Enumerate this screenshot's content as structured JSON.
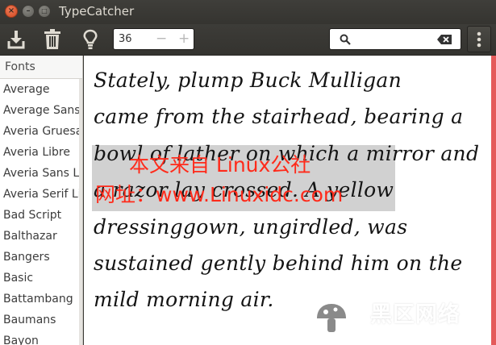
{
  "window": {
    "title": "TypeCatcher",
    "close_glyph": "×",
    "minimize_glyph": "–",
    "maximize_glyph": "□"
  },
  "toolbar": {
    "download_icon": "download-icon",
    "delete_icon": "trash-icon",
    "info_icon": "lightbulb-icon",
    "font_size": "36",
    "decrease_label": "−",
    "increase_label": "+",
    "search_value": "",
    "search_icon": "search-icon",
    "clear_icon": "backspace-clear-icon",
    "menu_icon": "vertical-ellipsis-icon"
  },
  "sidebar": {
    "header": "Fonts",
    "items": [
      {
        "label": "Average"
      },
      {
        "label": "Average Sans"
      },
      {
        "label": "Averia Gruesa"
      },
      {
        "label": "Averia Libre"
      },
      {
        "label": "Averia Sans Li"
      },
      {
        "label": "Averia Serif Li"
      },
      {
        "label": "Bad Script"
      },
      {
        "label": "Balthazar"
      },
      {
        "label": "Bangers"
      },
      {
        "label": "Basic"
      },
      {
        "label": "Battambang"
      },
      {
        "label": "Baumans"
      },
      {
        "label": "Bayon"
      }
    ]
  },
  "preview": {
    "lines": [
      "Stately, plump Buck Mulligan",
      "came from the stairhead, bearing a",
      "bowl of lather on which a mirror and",
      "a razor lay crossed. A yellow",
      "dressinggown, ungirdled, was",
      "sustained gently behind him on the",
      "mild morning air."
    ]
  },
  "watermark": {
    "line1": "本文来自 Linux公社",
    "line2": "网址：www.Linuxidc.com",
    "color": "#ff2a1a"
  },
  "brand": {
    "name": "黑区网络",
    "url": "www.heiqu.com",
    "logo_icon": "mushroom-logo-icon"
  },
  "colors": {
    "titlebar": "#3c3b37",
    "close_button": "#e0552f",
    "accent_strip": "#e45a5a"
  }
}
